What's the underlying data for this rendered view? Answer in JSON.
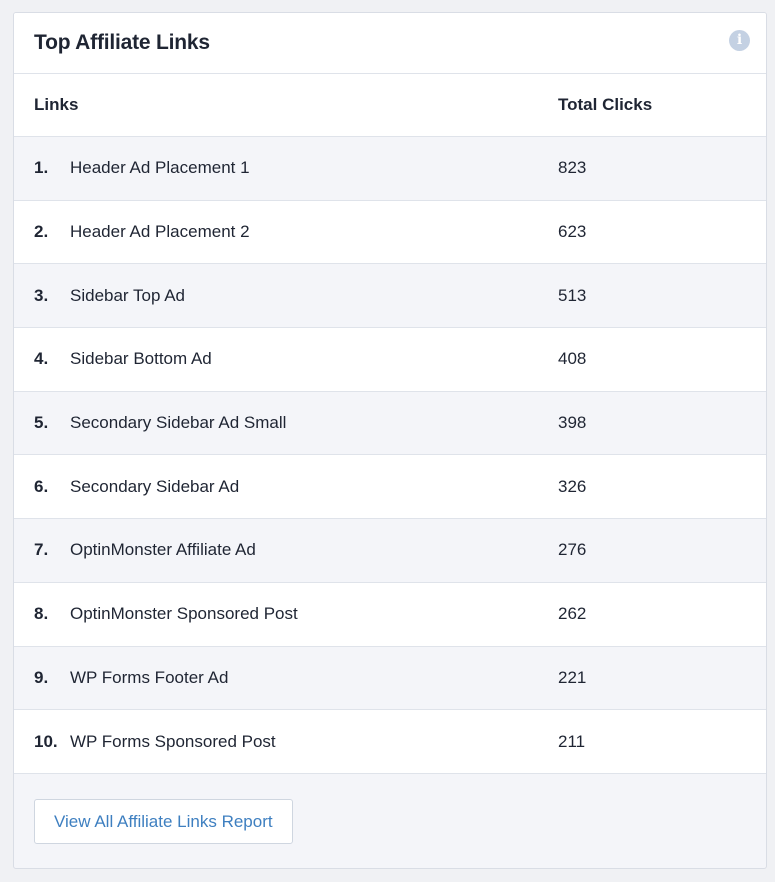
{
  "widget": {
    "title": "Top Affiliate Links",
    "info_icon": "info-icon"
  },
  "table": {
    "headers": {
      "links": "Links",
      "clicks": "Total Clicks"
    },
    "rows": [
      {
        "rank": "1.",
        "name": "Header Ad Placement 1",
        "clicks": "823"
      },
      {
        "rank": "2.",
        "name": "Header Ad Placement 2",
        "clicks": "623"
      },
      {
        "rank": "3.",
        "name": "Sidebar Top Ad",
        "clicks": "513"
      },
      {
        "rank": "4.",
        "name": "Sidebar Bottom Ad",
        "clicks": "408"
      },
      {
        "rank": "5.",
        "name": "Secondary Sidebar Ad Small",
        "clicks": "398"
      },
      {
        "rank": "6.",
        "name": "Secondary Sidebar Ad",
        "clicks": "326"
      },
      {
        "rank": "7.",
        "name": "OptinMonster Affiliate Ad",
        "clicks": "276"
      },
      {
        "rank": "8.",
        "name": "OptinMonster Sponsored Post",
        "clicks": "262"
      },
      {
        "rank": "9.",
        "name": "WP Forms Footer Ad",
        "clicks": "221"
      },
      {
        "rank": "10.",
        "name": "WP Forms Sponsored Post",
        "clicks": "211"
      }
    ]
  },
  "footer": {
    "button_label": "View All Affiliate Links Report"
  },
  "colors": {
    "accent": "#3e7fc0",
    "text": "#1f2533",
    "info_icon": "#c4d1e3"
  }
}
